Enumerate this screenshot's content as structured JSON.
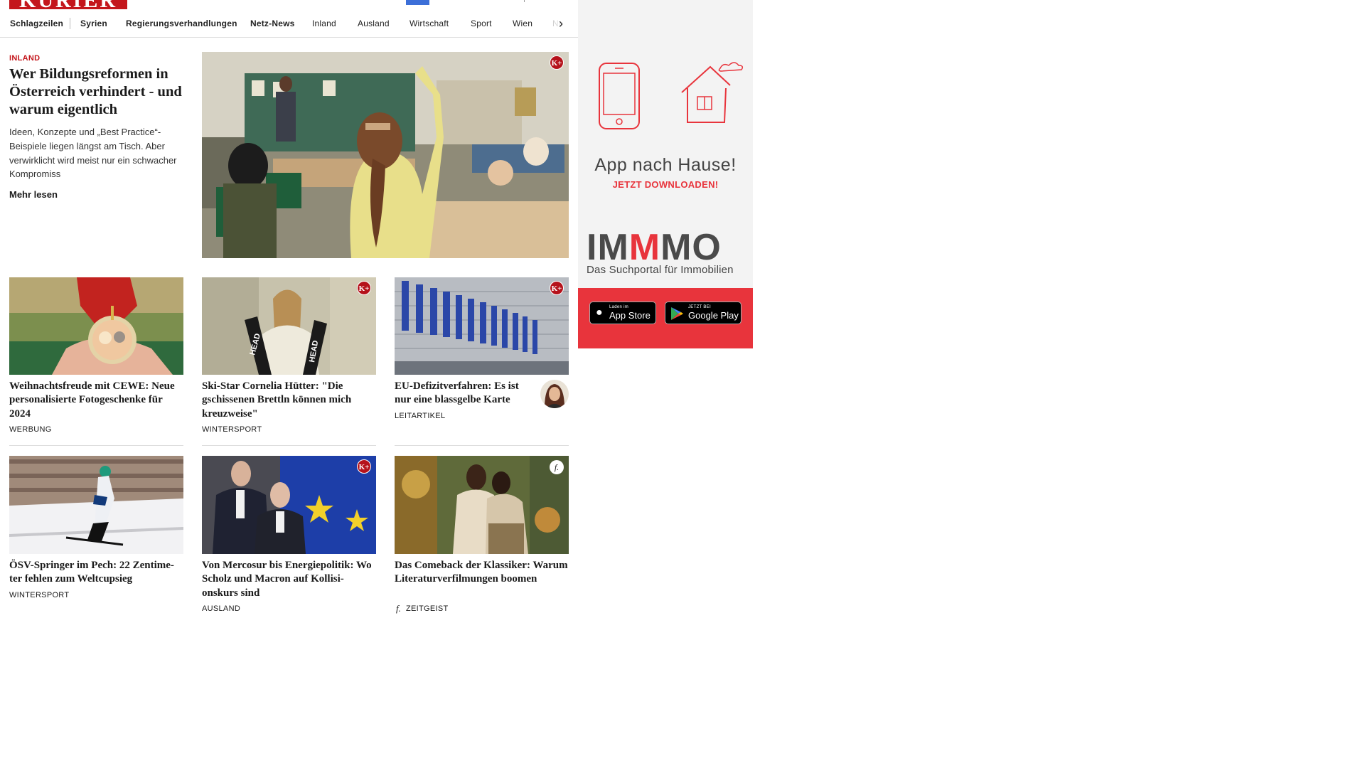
{
  "header": {
    "logo_text": "KURIER"
  },
  "nav": {
    "items": [
      {
        "label": "Schlagzeilen",
        "bold": true
      },
      {
        "label": "Syrien",
        "bold": true
      },
      {
        "label": "Regierungsverhandlungen",
        "bold": true
      },
      {
        "label": "Netz-News",
        "bold": true
      },
      {
        "label": "Inland",
        "bold": false
      },
      {
        "label": "Ausland",
        "bold": false
      },
      {
        "label": "Wirtschaft",
        "bold": false
      },
      {
        "label": "Sport",
        "bold": false
      },
      {
        "label": "Wien",
        "bold": false
      },
      {
        "label": "Ne",
        "bold": false
      }
    ],
    "next_arrow": "›"
  },
  "hero": {
    "kicker": "INLAND",
    "title": "Wer Bildungsreformen in Österreich verhindert - und warum eigentlich",
    "teaser": "Ideen, Konzepte und „Best Practice“-Beispiele liegen längst am Tisch. Aber verwirklicht wird meist nur ein schwacher Kompromiss",
    "more_label": "Mehr lesen",
    "badge": "K+"
  },
  "cards": [
    {
      "title": "Weihnachtsfreude mit CEWE: Neue personalisierte Fotogeschenke für 2024",
      "category": "WERBUNG",
      "badge": ""
    },
    {
      "title": "Ski-Star Cornelia Hütter: \"Die gschissenen Brettln können mich kreuzweise\"",
      "category": "WINTERSPORT",
      "badge": "K+"
    },
    {
      "title": "EU-Defizitverfahren: Es ist nur eine blassgelbe Karte",
      "category": "LEITARTIKEL",
      "badge": "K+"
    },
    {
      "title": "ÖSV-Springer im Pech: 22 Zentime-ter fehlen zum Weltcupsieg",
      "category": "WINTERSPORT",
      "badge": ""
    },
    {
      "title": "Von Mercosur bis Energiepolitik: Wo Scholz und Macron auf Kollisi-onskurs sind",
      "category": "AUSLAND",
      "badge": "K+"
    },
    {
      "title": "Das Comeback der Klassiker: Warum Literaturverfilmungen boomen",
      "category": "ZEITGEIST",
      "badge": "f."
    }
  ],
  "ad": {
    "headline": "App nach Hause!",
    "cta": "JETZT DOWNLOADEN!",
    "brand_pre": "IM",
    "brand_mid": "M",
    "brand_post": "MO",
    "tagline": "Das Suchportal für Immobilien",
    "appstore_small": "Laden im",
    "appstore_big": "App Store",
    "googleplay_small": "JETZT BEI",
    "googleplay_big": "Google Play"
  },
  "colors": {
    "brand_red": "#c4161c",
    "ad_red": "#e8343c",
    "nav_blue": "#3c6fd8"
  }
}
